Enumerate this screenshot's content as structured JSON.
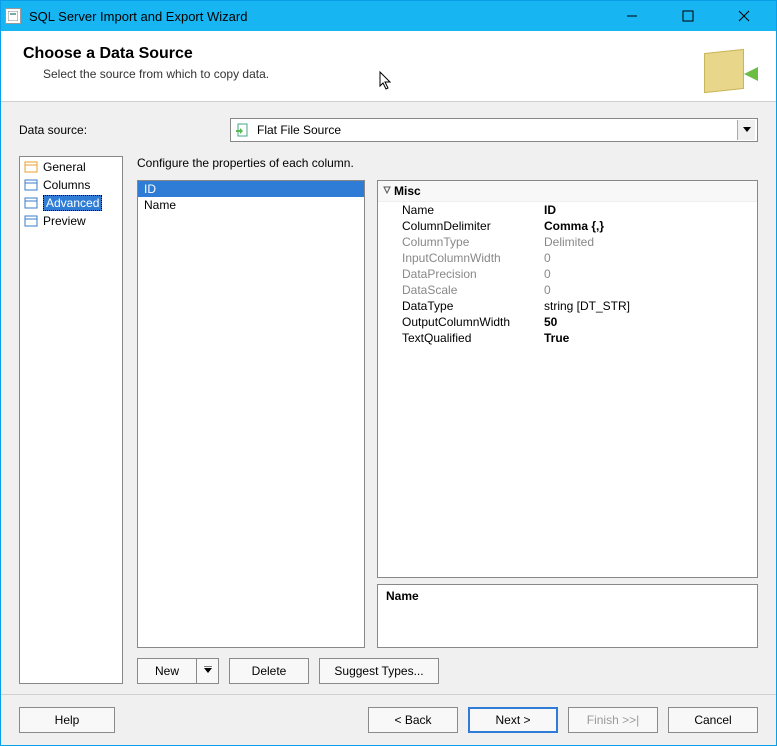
{
  "window": {
    "title": "SQL Server Import and Export Wizard"
  },
  "header": {
    "title": "Choose a Data Source",
    "subtitle": "Select the source from which to copy data."
  },
  "data_source": {
    "label": "Data source:",
    "selected": "Flat File Source"
  },
  "sidebar": {
    "items": [
      {
        "label": "General"
      },
      {
        "label": "Columns"
      },
      {
        "label": "Advanced"
      },
      {
        "label": "Preview"
      }
    ],
    "selected_index": 2
  },
  "instruction": "Configure the properties of each column.",
  "columns_list": {
    "items": [
      "ID",
      "Name"
    ],
    "selected_index": 0
  },
  "properties": {
    "group": "Misc",
    "rows": [
      {
        "key": "Name",
        "value": "ID",
        "bold": true
      },
      {
        "key": "ColumnDelimiter",
        "value": "Comma {,}",
        "bold": true
      },
      {
        "key": "ColumnType",
        "value": "Delimited",
        "dim": true
      },
      {
        "key": "InputColumnWidth",
        "value": "0",
        "dim": true
      },
      {
        "key": "DataPrecision",
        "value": "0",
        "dim": true
      },
      {
        "key": "DataScale",
        "value": "0",
        "dim": true
      },
      {
        "key": "DataType",
        "value": "string [DT_STR]"
      },
      {
        "key": "OutputColumnWidth",
        "value": "50",
        "bold": true
      },
      {
        "key": "TextQualified",
        "value": "True",
        "bold": true
      }
    ]
  },
  "description_panel": {
    "title": "Name"
  },
  "mid_buttons": {
    "new": "New",
    "delete": "Delete",
    "suggest": "Suggest Types..."
  },
  "footer_buttons": {
    "help": "Help",
    "back": "< Back",
    "next": "Next >",
    "finish": "Finish >>|",
    "cancel": "Cancel"
  }
}
